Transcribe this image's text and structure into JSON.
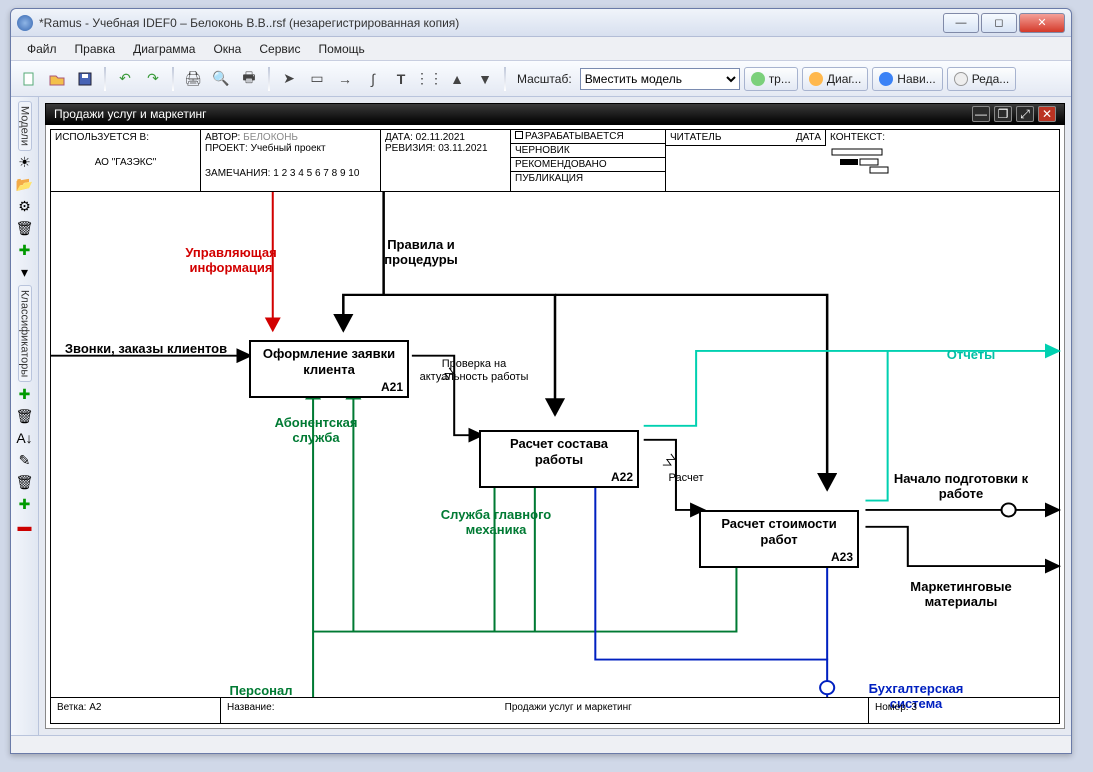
{
  "window": {
    "title": "*Ramus - Учебная IDEF0 – Белоконь В.В..rsf (незарегистрированная копия)"
  },
  "menu": [
    "Файл",
    "Правка",
    "Диаграмма",
    "Окна",
    "Сервис",
    "Помощь"
  ],
  "toolbar": {
    "zoom_label": "Масштаб:",
    "zoom_value": "Вместить модель",
    "tabs": [
      "тр...",
      "Диаг...",
      "Нави...",
      "Реда..."
    ]
  },
  "sidebar": {
    "panels": [
      "Модели",
      "Классификаторы"
    ]
  },
  "doc": {
    "title": "Продажи услуг и маркетинг",
    "header": {
      "used_in_label": "ИСПОЛЬЗУЕТСЯ В:",
      "used_in_value": "АО \"ГАЗЭКС\"",
      "author_label": "АВТОР:",
      "author_value": "БЕЛОКОНЬ",
      "project_label": "ПРОЕКТ:",
      "project_value": "Учебный проект",
      "notes_label": "ЗАМЕЧАНИЯ:",
      "notes_value": "1 2 3 4 5 6 7 8 9 10",
      "date_label": "ДАТА:",
      "date_value": "02.11.2021",
      "rev_label": "РЕВИЗИЯ:",
      "rev_value": "03.11.2021",
      "statuses": [
        "РАЗРАБАТЫВАЕТСЯ",
        "ЧЕРНОВИК",
        "РЕКОМЕНДОВАНО",
        "ПУБЛИКАЦИЯ"
      ],
      "reader_label": "ЧИТАТЕЛЬ",
      "reader_date_label": "ДАТА",
      "context_label": "КОНТЕКСТ:"
    },
    "footer": {
      "branch_label": "Ветка:",
      "branch_value": "A2",
      "name_label": "Название:",
      "name_value": "Продажи услуг и маркетинг",
      "num_label": "Номер:",
      "num_value": "3"
    }
  },
  "chart_data": {
    "type": "diagram",
    "notation": "IDEF0",
    "boxes": [
      {
        "id": "A21",
        "label": "Оформление заявки клиента"
      },
      {
        "id": "A22",
        "label": "Расчет состава работы"
      },
      {
        "id": "A23",
        "label": "Расчет стоимости работ"
      }
    ],
    "arrows": [
      {
        "name": "Звонки, заказы клиентов",
        "to": "A21",
        "side": "input",
        "color": "#000"
      },
      {
        "name": "Управляющая информация",
        "to": "A21",
        "side": "control",
        "color": "#d20000"
      },
      {
        "name": "Правила и процедуры",
        "to": [
          "A21",
          "A22",
          "A23"
        ],
        "side": "control",
        "color": "#000"
      },
      {
        "name": "Абонентская служба",
        "to": "A21",
        "side": "mechanism",
        "color": "#007a33"
      },
      {
        "name": "Персонал",
        "to": [
          "A21",
          "A22",
          "A23"
        ],
        "side": "mechanism",
        "color": "#007a33"
      },
      {
        "name": "Служба главного механика",
        "to": "A22",
        "side": "mechanism",
        "color": "#007a33"
      },
      {
        "name": "Бухгалтерская система",
        "to": [
          "A22",
          "A23"
        ],
        "side": "mechanism",
        "color": "#0020c0"
      },
      {
        "name": "Проверка на актуальность работы",
        "from": "A21",
        "to": "A22",
        "side": "output",
        "color": "#000"
      },
      {
        "name": "Расчет",
        "from": "A22",
        "to": "A23",
        "side": "output",
        "color": "#000"
      },
      {
        "name": "Отчеты",
        "from": [
          "A22",
          "A23"
        ],
        "side": "output",
        "color": "#00bfa5"
      },
      {
        "name": "Начало подготовки к работе",
        "from": "A23",
        "side": "output",
        "color": "#000"
      },
      {
        "name": "Маркетинговые материалы",
        "from": "A23",
        "side": "output",
        "color": "#000"
      }
    ]
  }
}
